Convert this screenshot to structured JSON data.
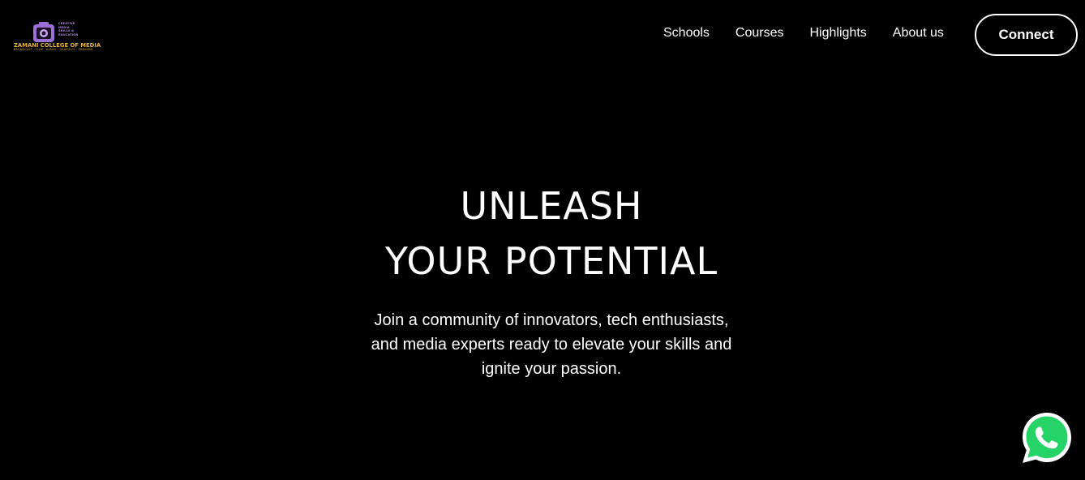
{
  "brand": {
    "name": "ZAMANI COLLEGE OF MEDIA",
    "tagline": "CREATIVE MEDIA SKILLS & EDUCATION",
    "subline": "BROADCAST · FILM · AUDIO · GRAPHICS · TRAINING",
    "logo_icon": "camera-icon",
    "colors": {
      "accent_purple": "#9b6fd6",
      "accent_gold": "#e7b43a"
    }
  },
  "nav": {
    "items": [
      {
        "label": "Schools"
      },
      {
        "label": "Courses"
      },
      {
        "label": "Highlights"
      },
      {
        "label": "About us"
      }
    ],
    "cta_label": "Connect"
  },
  "hero": {
    "title_line1": "UNLEASH",
    "title_line2": "YOUR POTENTIAL",
    "subtitle": "Join a community of innovators, tech enthusiasts, and media experts ready to elevate your skills and ignite your passion."
  },
  "floating": {
    "whatsapp_icon": "whatsapp-icon",
    "whatsapp_color": "#25d366"
  },
  "theme": {
    "background": "#000000",
    "text": "#ffffff"
  }
}
